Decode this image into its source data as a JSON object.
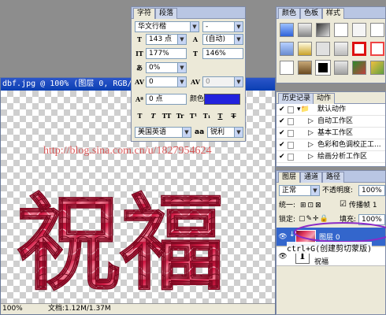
{
  "document": {
    "title": "dbf.jpg @ 100% (图层 0, RGB/8#",
    "zoom": "100%",
    "status_label": "文档:1.12M/1.37M",
    "artwork_text": "祝福",
    "watermark": "http://blog.sina.com.cn/u/1827954624"
  },
  "character_panel": {
    "tabs": [
      "字符",
      "段落"
    ],
    "font_family": "华文行楷",
    "font_style": "-",
    "font_size": "143 点",
    "leading": "(自动)",
    "vertical_scale": "177%",
    "horizontal_scale": "146%",
    "tracking": "0%",
    "kerning": "0",
    "kerning_alt": "0",
    "baseline_shift": "0 点",
    "color_label": "颜色:",
    "text_color": "#2222dd",
    "format_buttons": [
      "T",
      "T",
      "TT",
      "Tr",
      "T¹",
      "T₁",
      "T",
      "T"
    ],
    "language": "美国英语",
    "antialias_icon_text": "aa",
    "antialias": "锐利"
  },
  "styles_panel": {
    "tabs": [
      "颜色",
      "色板",
      "样式"
    ]
  },
  "actions_panel": {
    "tabs": [
      "历史记录",
      "动作"
    ],
    "rows": [
      "默认动作",
      "自动工作区",
      "基本工作区",
      "色彩和色调校正工...",
      "绘画分析工作区"
    ]
  },
  "layers_panel": {
    "tabs": [
      "图层",
      "通道",
      "路径"
    ],
    "blend_mode": "正常",
    "opacity_label": "不透明度:",
    "opacity": "100%",
    "unify_label": "统一:",
    "propagate_label": "传播帧 1",
    "lock_label": "锁定:",
    "fill_label": "填充:",
    "fill": "100%",
    "layers": [
      {
        "name": "图层 0",
        "selected": true
      },
      {
        "name": "祝福",
        "selected": false,
        "icon": "T"
      }
    ]
  },
  "annotation": "ctrl+G(创建剪切蒙版)",
  "colors": {
    "titlebar": "#0a3fb3",
    "selection": "#3366cc",
    "artwork": "#c8103a"
  }
}
